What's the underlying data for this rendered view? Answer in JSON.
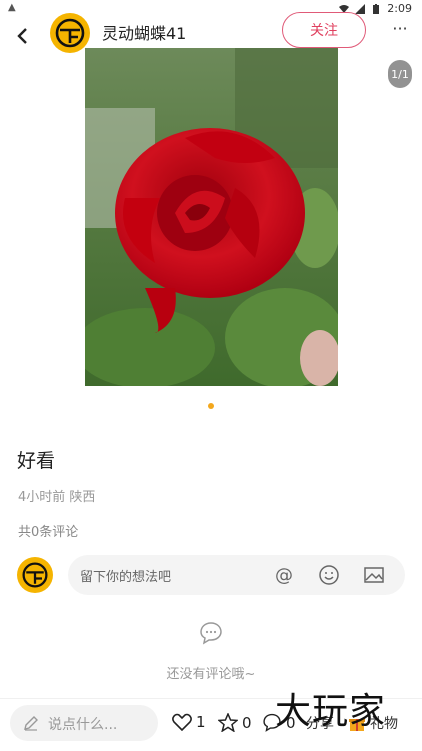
{
  "status_bar": {
    "time": "2:09"
  },
  "header": {
    "username": "灵动蝴蝶41",
    "follow_label": "关注",
    "more": "···"
  },
  "image": {
    "counter": "1/1"
  },
  "post": {
    "text": "好看",
    "meta": "4小时前 陕西",
    "comment_count": "共0条评论"
  },
  "comment_input": {
    "placeholder": "留下你的想法吧"
  },
  "empty_state": {
    "text": "还没有评论哦~"
  },
  "bottom_bar": {
    "say_placeholder": "说点什么...",
    "like_count": "1",
    "star_count": "0",
    "comment_count": "0",
    "share_label": "分享",
    "gift_label": "礼物"
  },
  "watermark": "大玩家",
  "colors": {
    "accent": "#e0405f",
    "avatar": "#f5b400",
    "dot": "#f3a71c"
  }
}
